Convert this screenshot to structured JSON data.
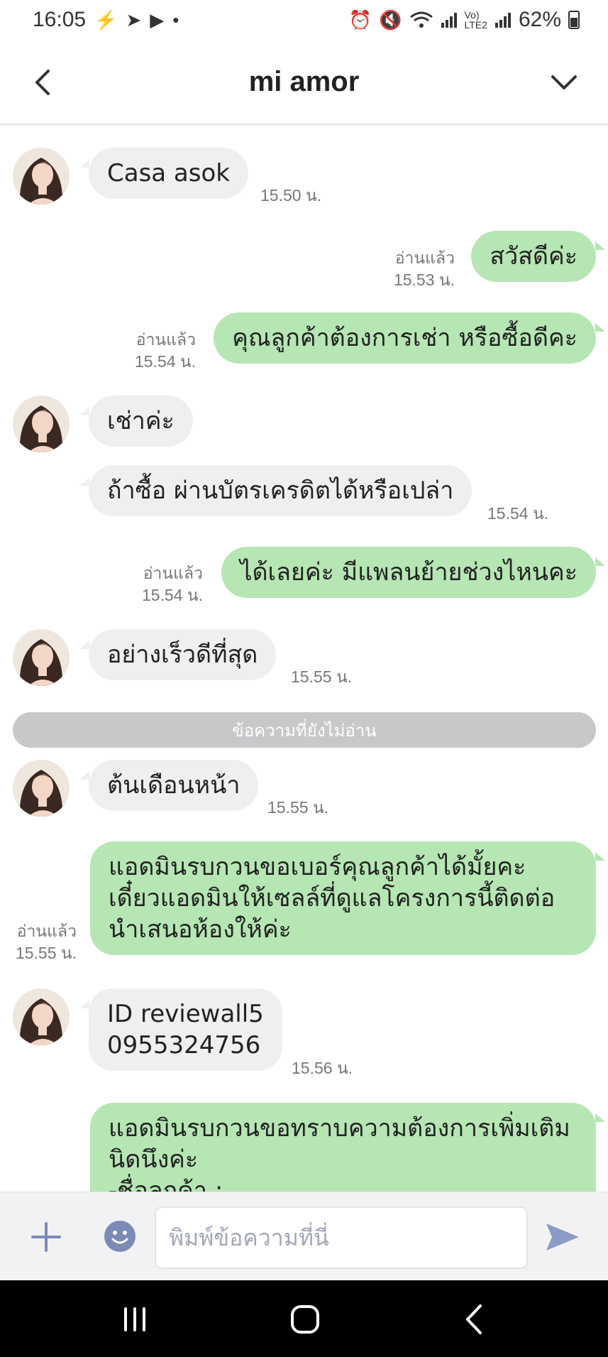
{
  "status": {
    "time": "16:05",
    "battery": "62%"
  },
  "header": {
    "title": "mi amor"
  },
  "chat": {
    "messages": [
      {
        "dir": "in",
        "text": "Casa asok",
        "time": "15.50 น."
      },
      {
        "dir": "out",
        "text": "สวัสดีค่ะ",
        "read": "อ่านแล้ว",
        "time": "15.53 น."
      },
      {
        "dir": "out",
        "text": "คุณลูกค้าต้องการเช่า หรือซื้อดีคะ",
        "read": "อ่านแล้ว",
        "time": "15.54 น."
      },
      {
        "dir": "in",
        "text": "เช่าค่ะ"
      },
      {
        "dir": "in",
        "text": "ถ้าซื้อ ผ่านบัตรเครดิตได้หรือเปล่า",
        "time": "15.54 น."
      },
      {
        "dir": "out",
        "text": "ได้เลยค่ะ มีแพลนย้ายช่วงไหนคะ",
        "read": "อ่านแล้ว",
        "time": "15.54 น."
      },
      {
        "dir": "in",
        "text": "อย่างเร็วดีที่สุด",
        "time": "15.55 น."
      },
      {
        "dir": "in",
        "text": "ต้นเดือนหน้า",
        "time": "15.55 น."
      },
      {
        "dir": "out",
        "lines": [
          "แอดมินรบกวนขอเบอร์คุณลูกค้าได้มั้ยคะ",
          "เดี๋ยวแอดมินให้เซลล์ที่ดูแลโครงการนี้ติดต่อ",
          "นำเสนอห้องให้ค่ะ"
        ],
        "read": "อ่านแล้ว",
        "time": "15.55 น."
      },
      {
        "dir": "in",
        "lines": [
          "ID reviewall5",
          "0955324756"
        ],
        "time": "15.56 น."
      },
      {
        "dir": "out",
        "lines": [
          "แอดมินรบกวนขอทราบความต้องการเพิ่มเติม",
          "นิดนึงค่ะ",
          "-ชื่อลูกค้า :"
        ]
      }
    ],
    "unread_divider": "ข้อความที่ยังไม่อ่าน"
  },
  "input": {
    "placeholder": "พิมพ์ข้อความที่นี่"
  },
  "colors": {
    "incoming_bubble": "#efeff1",
    "outgoing_bubble": "#b6e6b4",
    "unread_divider": "#c8c8cb",
    "send_icon": "#8a9bc6"
  }
}
